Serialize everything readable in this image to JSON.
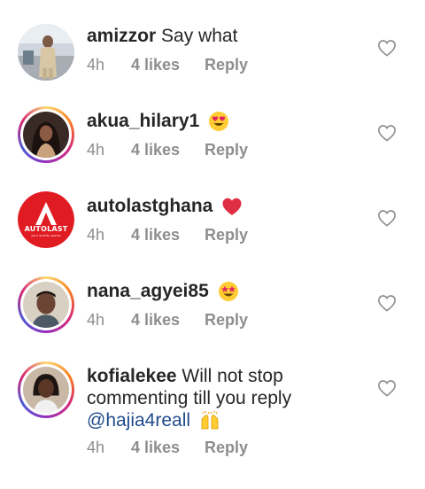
{
  "comments": [
    {
      "username": "amizzor",
      "text": "Say what",
      "mention": "",
      "time": "4h",
      "likes": "4 likes",
      "reply": "Reply",
      "emoji": ""
    },
    {
      "username": "akua_hilary1",
      "text": "",
      "mention": "",
      "time": "4h",
      "likes": "4 likes",
      "reply": "Reply",
      "emoji": "heart-eyes-emoji"
    },
    {
      "username": "autolastghana",
      "text": "",
      "mention": "",
      "time": "4h",
      "likes": "4 likes",
      "reply": "Reply",
      "emoji": "red-heart-emoji"
    },
    {
      "username": "nana_agyei85",
      "text": "",
      "mention": "",
      "time": "4h",
      "likes": "4 likes",
      "reply": "Reply",
      "emoji": "star-struck-emoji"
    },
    {
      "username": "kofialekee",
      "text": "Will not stop commenting till you reply",
      "mention": "@hajia4reall",
      "time": "4h",
      "likes": "4 likes",
      "reply": "Reply",
      "emoji": "raising-hands-emoji"
    }
  ],
  "avatars": {
    "autolastghana": {
      "logo_text": "AUTOLAST",
      "tagline": "your quality spares"
    }
  },
  "colors": {
    "meta_text": "#8e8e8e",
    "mention": "#1f4a8c",
    "heart_emoji": "#e0245e",
    "autolast_red": "#e11b22"
  }
}
